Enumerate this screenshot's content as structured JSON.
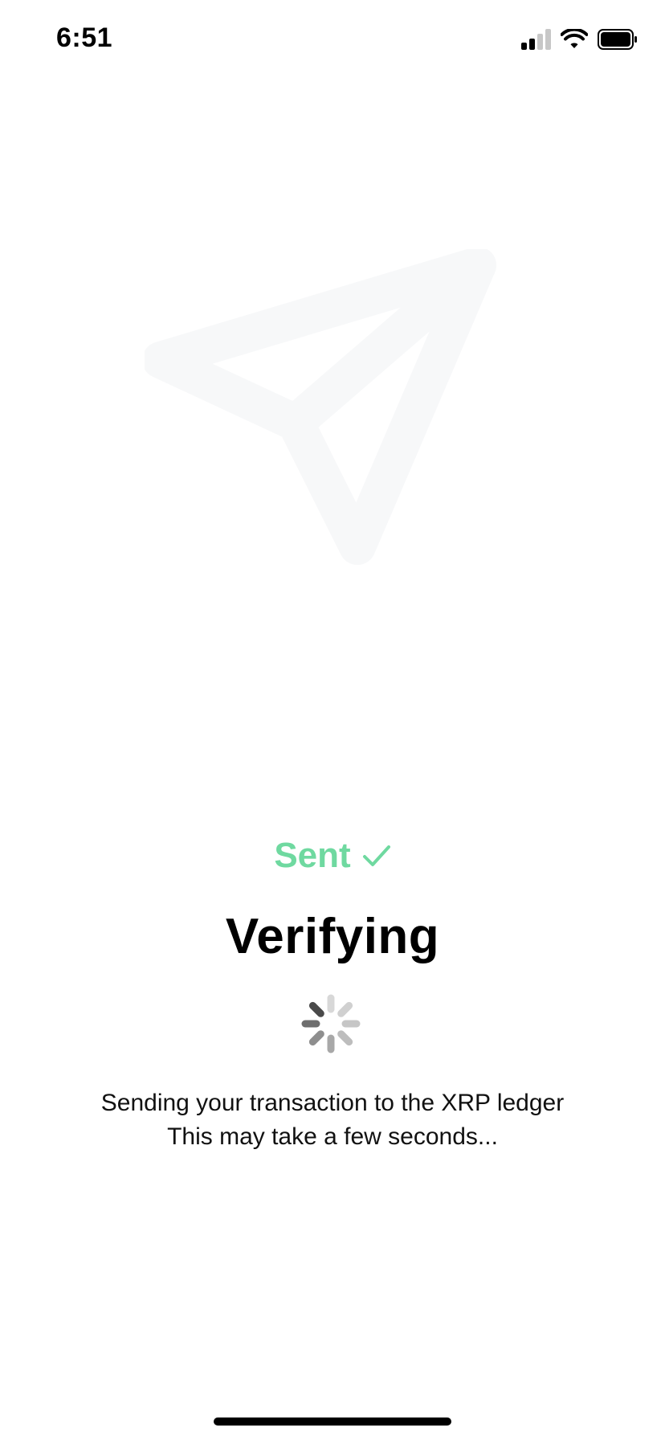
{
  "status_bar": {
    "time": "6:51",
    "icons": [
      "signal-icon",
      "wifi-icon",
      "battery-icon"
    ]
  },
  "hero": {
    "icon": "send-paper-plane-icon"
  },
  "status": {
    "sent_label": "Sent",
    "sent_color": "#6fd9a0",
    "sent_icon": "checkmark-icon"
  },
  "main": {
    "title": "Verifying",
    "spinner_icon": "loading-spinner-icon",
    "message_line1": "Sending your transaction to the XRP ledger",
    "message_line2": "This may take a few seconds..."
  }
}
